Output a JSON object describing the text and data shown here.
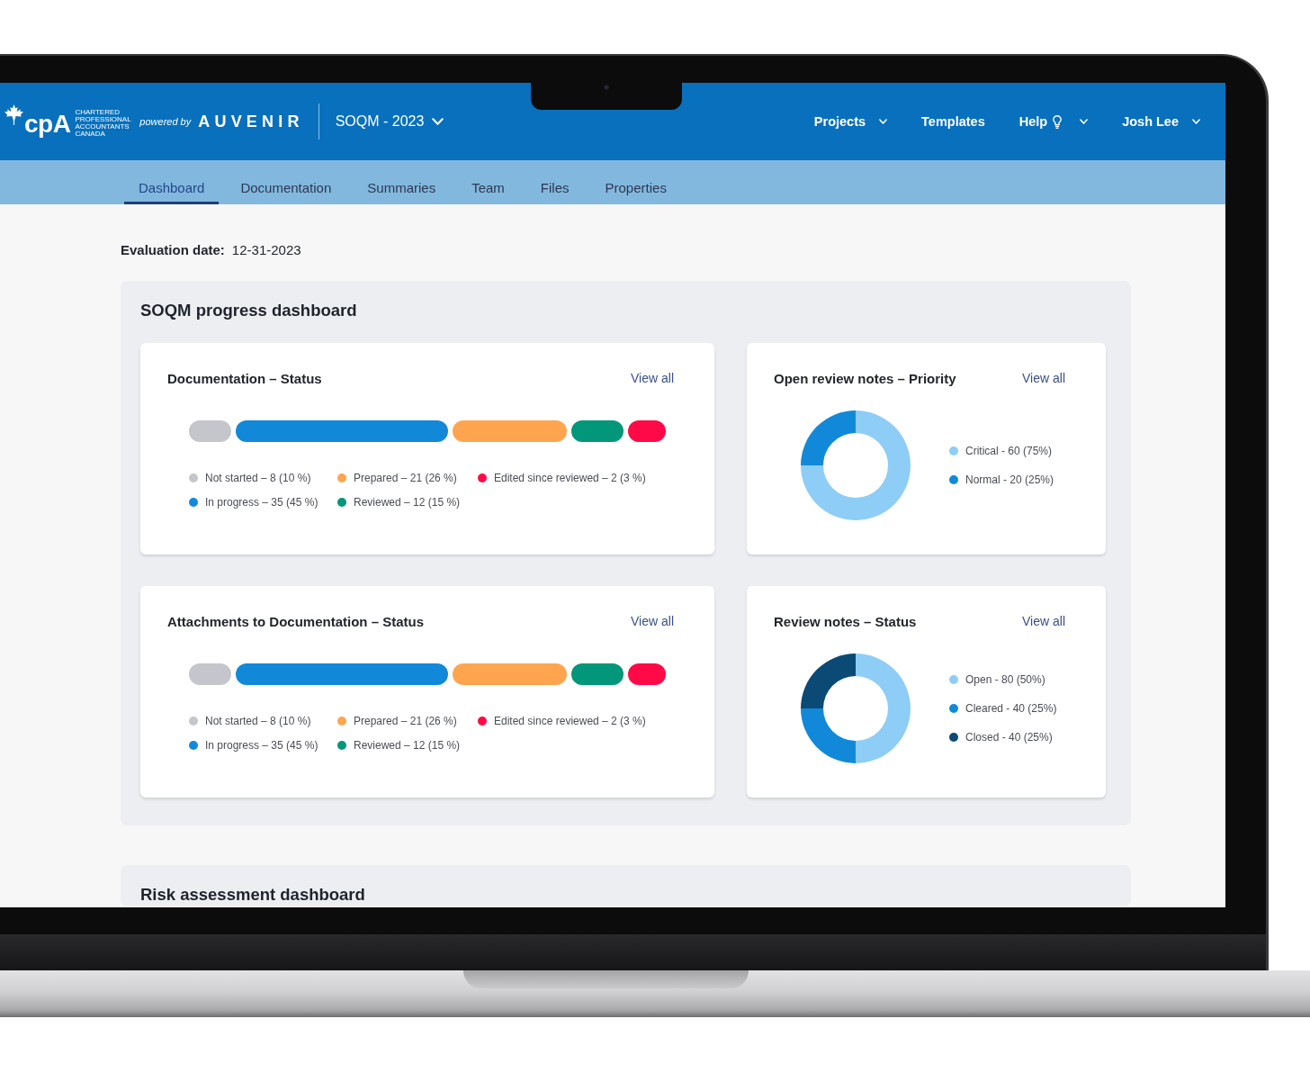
{
  "header": {
    "logo": {
      "mark": "cpA",
      "tagline": "CHARTERED PROFESSIONAL ACCOUNTANTS CANADA"
    },
    "powered_by": "powered by",
    "brand": "AUVENIR",
    "project": "SOQM - 2023",
    "nav": [
      {
        "label": "Projects",
        "kind": "menu"
      },
      {
        "label": "Templates",
        "kind": "link"
      },
      {
        "label": "Help",
        "kind": "help"
      },
      {
        "label": "Josh Lee",
        "kind": "menu"
      }
    ]
  },
  "tabs": [
    {
      "label": "Dashboard",
      "selected": true
    },
    {
      "label": "Documentation",
      "selected": false
    },
    {
      "label": "Summaries",
      "selected": false
    },
    {
      "label": "Team",
      "selected": false
    },
    {
      "label": "Files",
      "selected": false
    },
    {
      "label": "Properties",
      "selected": false
    }
  ],
  "evaluation_date": {
    "label": "Evaluation date:",
    "value": "12-31-2023"
  },
  "dashboards": [
    {
      "title": "SOQM progress dashboard",
      "cards": [
        {
          "kind": "status",
          "title": "Documentation – Status",
          "link": "View all",
          "legend": [
            {
              "label": "Not started – 8 (10 %)",
              "color": "#c4c6cc"
            },
            {
              "label": "In progress – 35 (45 %)",
              "color": "#1289d8"
            },
            {
              "label": "Prepared – 21 (26 %)",
              "color": "#ffa54f"
            },
            {
              "label": "Reviewed – 12 (15 %)",
              "color": "#02977a"
            },
            {
              "label": "Edited since reviewed – 2 (3 %)",
              "color": "#ff0a47"
            }
          ]
        },
        {
          "kind": "donut",
          "title": "Open review notes – Priority",
          "link": "View all",
          "chart_data": {
            "type": "donut",
            "values": [
              75,
              25
            ]
          },
          "legend": [
            {
              "label": "Critical - 60 (75%)",
              "color": "#8dcdf6"
            },
            {
              "label": "Normal - 20 (25%)",
              "color": "#1289d8"
            }
          ]
        },
        {
          "kind": "status",
          "title": "Attachments to Documentation – Status",
          "link": "View all",
          "legend": [
            {
              "label": "Not started – 8 (10 %)",
              "color": "#c4c6cc"
            },
            {
              "label": "In progress – 35 (45 %)",
              "color": "#1289d8"
            },
            {
              "label": "Prepared – 21 (26 %)",
              "color": "#ffa54f"
            },
            {
              "label": "Reviewed – 12 (15 %)",
              "color": "#02977a"
            },
            {
              "label": "Edited since reviewed – 2 (3 %)",
              "color": "#ff0a47"
            }
          ]
        },
        {
          "kind": "donut",
          "title": "Review notes – Status",
          "link": "View all",
          "chart_data": {
            "type": "donut",
            "values": [
              50,
              25,
              25
            ]
          },
          "legend": [
            {
              "label": "Open - 80 (50%)",
              "color": "#8dcdf6"
            },
            {
              "label": "Cleared - 40 (25%)",
              "color": "#1289d8"
            },
            {
              "label": "Closed - 40 (25%)",
              "color": "#0b4a74"
            }
          ]
        }
      ]
    },
    {
      "title": "Risk assessment dashboard"
    }
  ]
}
